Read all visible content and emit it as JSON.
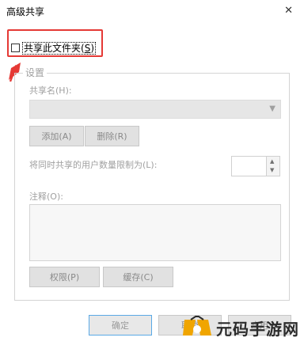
{
  "window": {
    "title": "高级共享",
    "close_glyph": "✕"
  },
  "share_checkbox": {
    "checked": false,
    "label_prefix": "共享此文件夹(",
    "label_key": "S",
    "label_suffix": ")"
  },
  "settings": {
    "legend": "设置",
    "share_name_label": "共享名(H):",
    "share_name_value": "",
    "add_button": "添加(A)",
    "remove_button": "删除(R)",
    "limit_label": "将同时共享的用户数量限制为(L):",
    "limit_value": "",
    "comment_label": "注释(O):",
    "comment_value": "",
    "permissions_button": "权限(P)",
    "caching_button": "缓存(C)"
  },
  "footer": {
    "ok": "确定",
    "cancel": "取消",
    "apply": "应用"
  },
  "annotation": {
    "highlight_color": "#e53935"
  },
  "watermark": {
    "text": "元码手游网"
  }
}
